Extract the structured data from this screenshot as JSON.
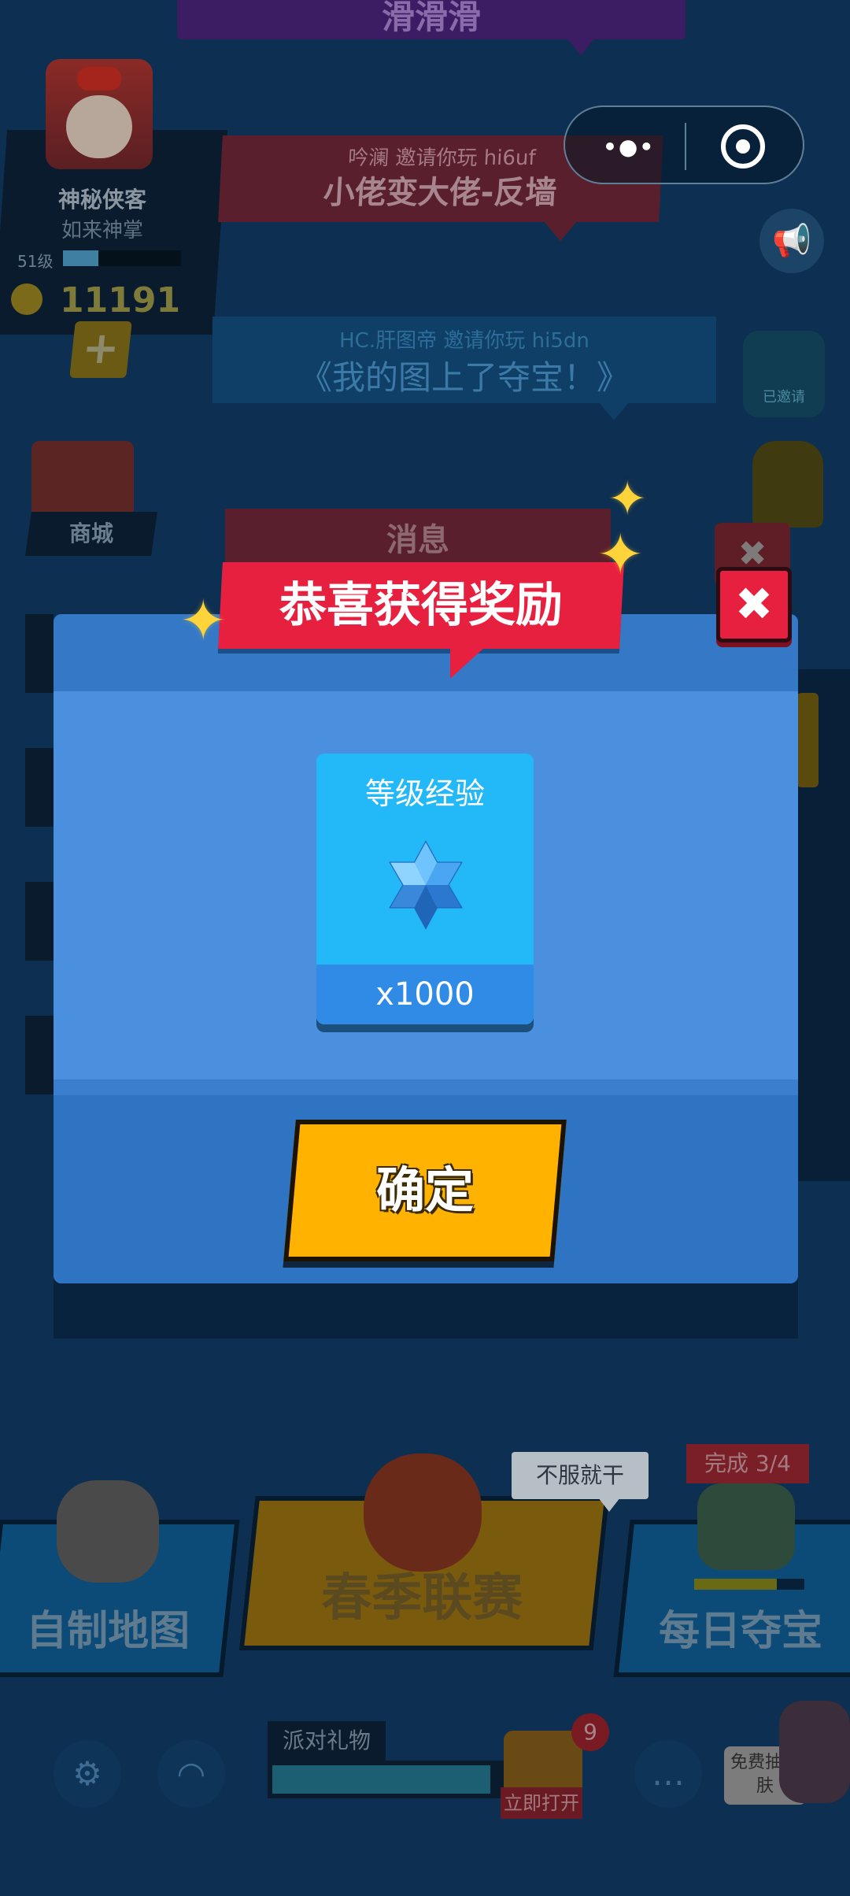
{
  "colors": {
    "modal_blue": "#4b90df",
    "title_red": "#e8203f",
    "confirm_yellow": "#ffb300",
    "card_cyan": "#23b8f7"
  },
  "top_banner": {
    "text": "滑滑滑"
  },
  "profile": {
    "name": "神秘侠客",
    "title": "如来神掌",
    "level": "51级",
    "level_progress": 0.3,
    "coins": "11191",
    "add_icon": "plus-icon"
  },
  "capsule": {
    "more_icon": "more-dots-icon",
    "close_icon": "target-icon",
    "more_text": "•●•"
  },
  "invites": [
    {
      "line1": "吟澜 邀请你玩 hi6uf",
      "line2": "小佬变大佬-反墙"
    },
    {
      "line1": "HC.肝图帝 邀请你玩 hi5dn",
      "line2": "《我的图上了夺宝！》"
    }
  ],
  "right_icons": {
    "megaphone": "megaphone-icon",
    "flag_badge_label": "已邀请"
  },
  "shop": {
    "label": "商城"
  },
  "background_message": {
    "title": "消息"
  },
  "modal": {
    "title": "恭喜获得奖励",
    "close_symbol": "✖",
    "reward": {
      "name": "等级经验",
      "amount": "x1000",
      "icon": "crystal-star-icon"
    },
    "confirm_label": "确定"
  },
  "modes": [
    {
      "label": "自制地图"
    },
    {
      "label": "春季联赛",
      "tag": "不服就干"
    },
    {
      "label": "每日夺宝",
      "tag": "完成 3/4",
      "progress": 0.75
    }
  ],
  "bottom_nav": {
    "settings_icon": "gear-icon",
    "service_icon": "headset-icon",
    "party_label": "派对礼物",
    "party_progress": 0.9,
    "chest_badge": "9",
    "open_label": "立即打开",
    "chat_icon": "chat-icon",
    "skin_label": "免费抽皮肤"
  }
}
